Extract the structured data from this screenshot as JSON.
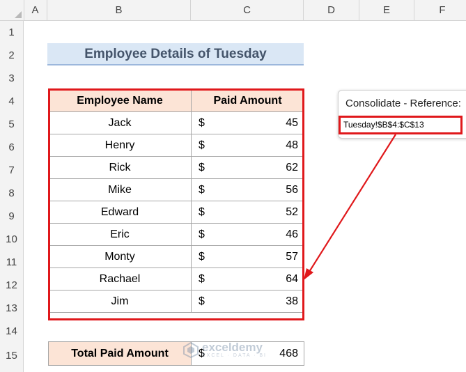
{
  "sheet": {
    "columns": [
      "A",
      "B",
      "C",
      "D",
      "E",
      "F"
    ],
    "rows": [
      "1",
      "2",
      "3",
      "4",
      "5",
      "6",
      "7",
      "8",
      "9",
      "10",
      "11",
      "12",
      "13",
      "14",
      "15"
    ]
  },
  "title": "Employee Details of Tuesday",
  "table": {
    "headers": {
      "name": "Employee Name",
      "amount": "Paid Amount"
    },
    "rows": [
      {
        "name": "Jack",
        "currency": "$",
        "amount": "45"
      },
      {
        "name": "Henry",
        "currency": "$",
        "amount": "48"
      },
      {
        "name": "Rick",
        "currency": "$",
        "amount": "62"
      },
      {
        "name": "Mike",
        "currency": "$",
        "amount": "56"
      },
      {
        "name": "Edward",
        "currency": "$",
        "amount": "52"
      },
      {
        "name": "Eric",
        "currency": "$",
        "amount": "46"
      },
      {
        "name": "Monty",
        "currency": "$",
        "amount": "57"
      },
      {
        "name": "Rachael",
        "currency": "$",
        "amount": "64"
      },
      {
        "name": "Jim",
        "currency": "$",
        "amount": "38"
      }
    ]
  },
  "total": {
    "label": "Total Paid Amount",
    "currency": "$",
    "amount": "468"
  },
  "consolidate": {
    "title": "Consolidate - Reference:",
    "reference": "Tuesday!$B$4:$C$13"
  },
  "watermark": {
    "name": "exceldemy",
    "tagline": "EXCEL · DATA · BI"
  },
  "colors": {
    "header_fill": "#fce4d6",
    "title_fill": "#dae7f5",
    "highlight": "#e0181b"
  }
}
